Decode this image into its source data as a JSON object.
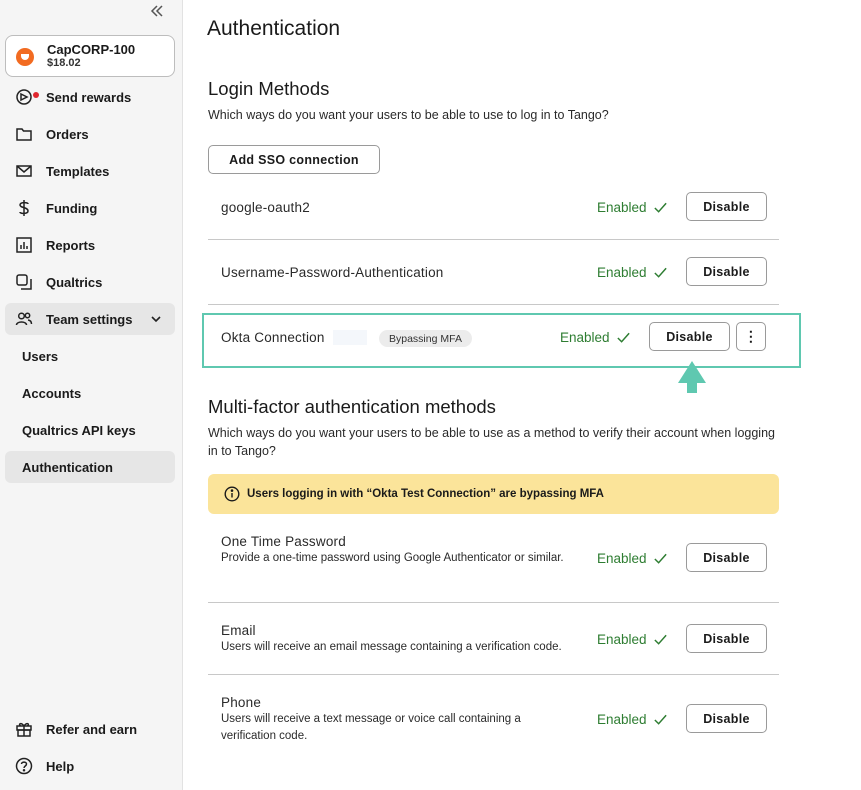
{
  "sidebar": {
    "account": {
      "name": "CapCORP-100",
      "balance": "$18.02"
    },
    "items": [
      {
        "label": "Send rewards"
      },
      {
        "label": "Orders"
      },
      {
        "label": "Templates"
      },
      {
        "label": "Funding"
      },
      {
        "label": "Reports"
      },
      {
        "label": "Qualtrics"
      },
      {
        "label": "Team settings"
      }
    ],
    "sub_items": [
      {
        "label": "Users"
      },
      {
        "label": "Accounts"
      },
      {
        "label": "Qualtrics API keys"
      },
      {
        "label": "Authentication"
      }
    ],
    "footer": [
      {
        "label": "Refer and earn"
      },
      {
        "label": "Help"
      }
    ]
  },
  "main": {
    "title": "Authentication",
    "login": {
      "heading": "Login Methods",
      "description": "Which ways do you want your users to be able to use to log in to Tango?",
      "add_sso_label": "Add SSO connection",
      "methods": [
        {
          "name": "google-oauth2",
          "status": "Enabled",
          "action": "Disable"
        },
        {
          "name": "Username-Password-Authentication",
          "status": "Enabled",
          "action": "Disable"
        },
        {
          "name": "Okta Connection",
          "badge": "Bypassing MFA",
          "status": "Enabled",
          "action": "Disable",
          "more": "⋮"
        }
      ]
    },
    "mfa": {
      "heading": "Multi-factor authentication methods",
      "description": "Which ways do you want your users to be able to use as a method to verify their account when logging in to Tango?",
      "alert": "Users logging in with “Okta Test Connection” are bypassing MFA",
      "methods": [
        {
          "name": "One Time Password",
          "sub": "Provide a one-time password using Google Authenticator or similar.",
          "status": "Enabled",
          "action": "Disable"
        },
        {
          "name": "Email",
          "sub": "Users will receive an email message containing a verification code.",
          "status": "Enabled",
          "action": "Disable"
        },
        {
          "name": "Phone",
          "sub": "Users will receive a text message or voice call containing a verification code.",
          "status": "Enabled",
          "action": "Disable"
        }
      ]
    }
  },
  "colors": {
    "enabled": "#2e7d32",
    "highlight": "#5fc8b0",
    "alert_bg": "#fbe49a",
    "brand": "#f26b21"
  },
  "icons": [
    "collapse-icon",
    "send-rewards-icon",
    "folder-icon",
    "mail-icon",
    "dollar-icon",
    "chart-icon",
    "qualtrics-icon",
    "team-icon",
    "chevron-down-icon",
    "gift-icon",
    "help-icon",
    "check-icon",
    "info-icon",
    "kebab-icon",
    "arrow-up-icon"
  ]
}
